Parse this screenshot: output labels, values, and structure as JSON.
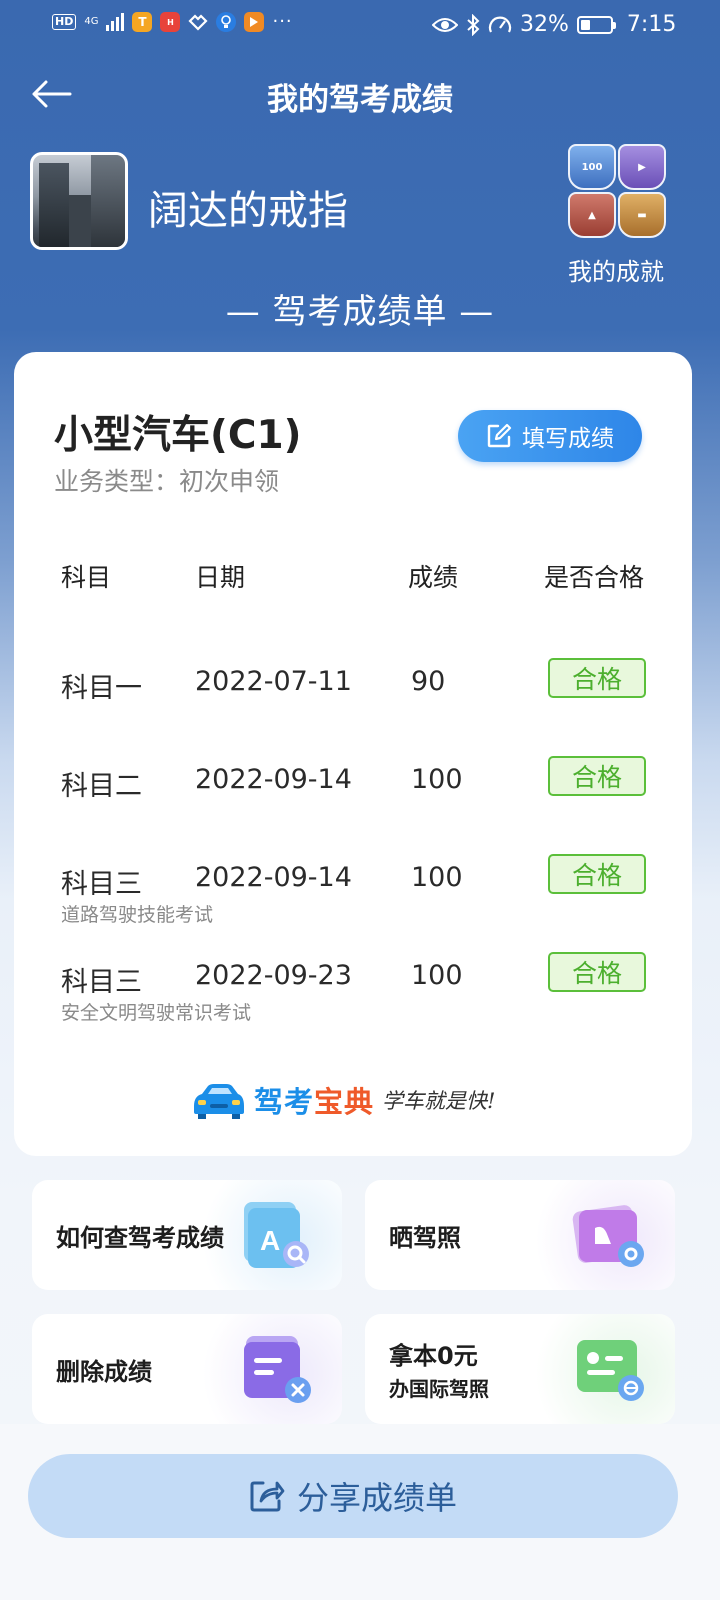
{
  "statusbar": {
    "network": "4G",
    "battery": "32%",
    "battery_level": 0.32,
    "time": "7:15"
  },
  "header": {
    "title": "我的驾考成绩",
    "back_icon": "arrow-left-icon"
  },
  "profile": {
    "username": "阔达的戒指",
    "achievements_label": "我的成就"
  },
  "section_title": "— 驾考成绩单 —",
  "card": {
    "car_type": "小型汽车(C1)",
    "biz_type": "业务类型：初次申领",
    "fill_button": "填写成绩",
    "columns": [
      "科目",
      "日期",
      "成绩",
      "是否合格"
    ],
    "rows": [
      {
        "subject": "科目一",
        "date": "2022-07-11",
        "score": "90",
        "status": "合格",
        "note": ""
      },
      {
        "subject": "科目二",
        "date": "2022-09-14",
        "score": "100",
        "status": "合格",
        "note": ""
      },
      {
        "subject": "科目三",
        "date": "2022-09-14",
        "score": "100",
        "status": "合格",
        "note": "道路驾驶技能考试"
      },
      {
        "subject": "科目三",
        "date": "2022-09-23",
        "score": "100",
        "status": "合格",
        "note": "安全文明驾驶常识考试"
      }
    ],
    "logo": {
      "name_a": "驾考",
      "name_b": "宝典",
      "slogan": "学车就是快!"
    }
  },
  "tiles": {
    "query": "如何查驾考成绩",
    "show_license": "晒驾照",
    "delete": "删除成绩",
    "intl_line1": "拿本0元",
    "intl_line2": "办国际驾照"
  },
  "share_button": "分享成绩单",
  "colors": {
    "primary": "#3a69b0",
    "accent": "#2e86e8",
    "pass_green": "#4caf2e"
  }
}
